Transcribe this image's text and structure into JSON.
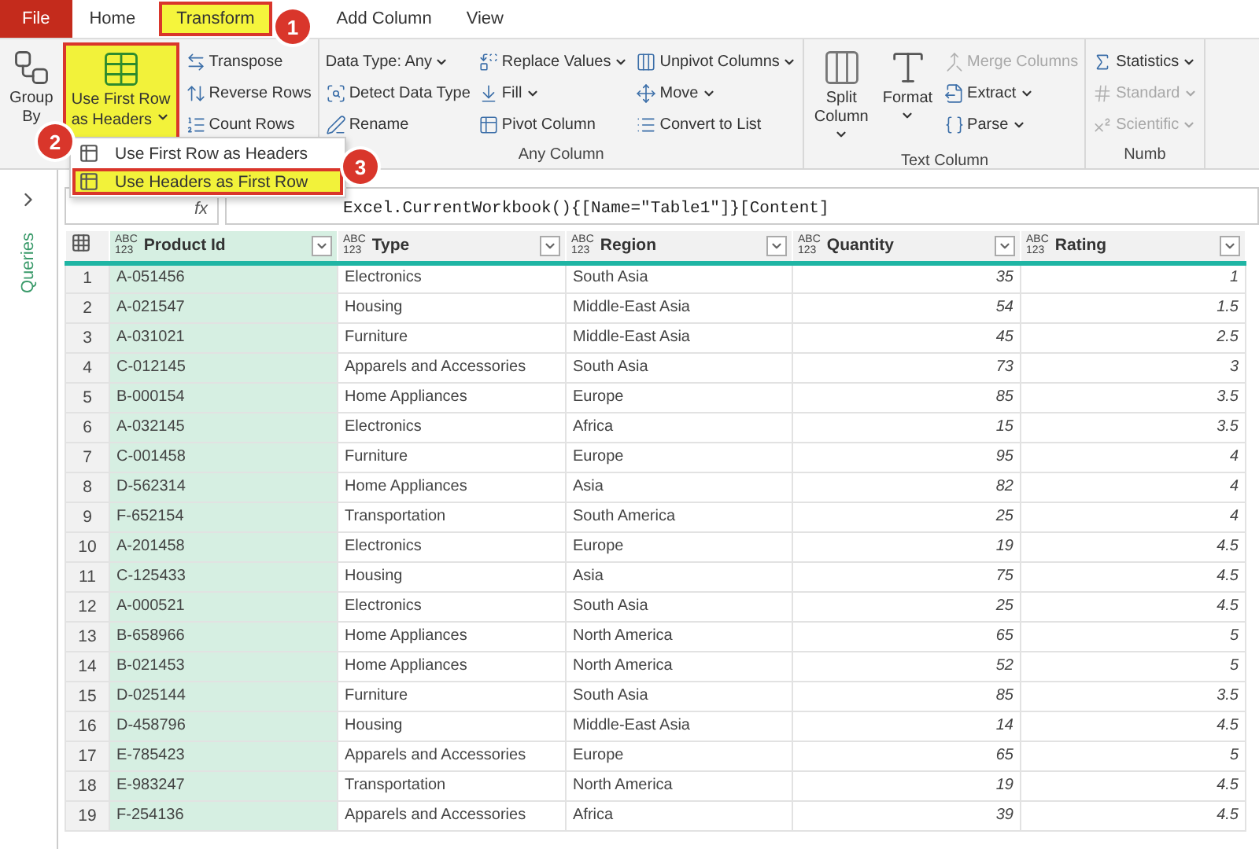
{
  "menu_tabs": [
    {
      "label": "File",
      "kind": "file",
      "selected": false
    },
    {
      "label": "Home",
      "kind": "tab",
      "selected": false
    },
    {
      "label": "Transform",
      "kind": "tab",
      "selected": true
    },
    {
      "label": "Add Column",
      "kind": "tab",
      "selected": false
    },
    {
      "label": "View",
      "kind": "tab",
      "selected": false
    }
  ],
  "ribbon": [
    {
      "columns": [
        {
          "kind": "large",
          "label": "Group By",
          "dropdown": false,
          "highlighted": false
        },
        {
          "kind": "large",
          "label": "Use First Row as Headers",
          "dropdown": true,
          "highlighted": true
        },
        {
          "kind": "stack",
          "items": [
            {
              "label": "Transpose",
              "dropdown": false,
              "disabled": false
            },
            {
              "label": "Reverse Rows",
              "dropdown": false,
              "disabled": false
            },
            {
              "label": "Count Rows",
              "dropdown": false,
              "disabled": false
            }
          ]
        }
      ]
    },
    {
      "label": "Any Column",
      "columns": [
        {
          "kind": "stack",
          "items": [
            {
              "label": "Data Type: Any",
              "dropdown": true,
              "disabled": false
            },
            {
              "label": "Detect Data Type",
              "dropdown": false,
              "disabled": false
            },
            {
              "label": "Rename",
              "dropdown": false,
              "disabled": false
            }
          ]
        },
        {
          "kind": "stack",
          "items": [
            {
              "label": "Replace Values",
              "dropdown": true,
              "disabled": false
            },
            {
              "label": "Fill",
              "dropdown": true,
              "disabled": false
            },
            {
              "label": "Pivot Column",
              "dropdown": false,
              "disabled": false
            }
          ]
        },
        {
          "kind": "stack",
          "items": [
            {
              "label": "Unpivot Columns",
              "dropdown": true,
              "disabled": false
            },
            {
              "label": "Move",
              "dropdown": true,
              "disabled": false
            },
            {
              "label": "Convert to List",
              "dropdown": false,
              "disabled": false
            }
          ]
        }
      ]
    },
    {
      "label": "Text Column",
      "columns": [
        {
          "kind": "large",
          "label": "Split Column",
          "dropdown": true,
          "highlighted": false
        },
        {
          "kind": "large",
          "label": "Format",
          "dropdown": true,
          "highlighted": false
        },
        {
          "kind": "stack",
          "items": [
            {
              "label": "Merge Columns",
              "dropdown": false,
              "disabled": true
            },
            {
              "label": "Extract",
              "dropdown": true,
              "disabled": false
            },
            {
              "label": "Parse",
              "dropdown": true,
              "disabled": false
            }
          ]
        }
      ]
    },
    {
      "label": "Numb",
      "columns": [
        {
          "kind": "stack",
          "items": [
            {
              "label": "Statistics",
              "dropdown": true,
              "disabled": false
            },
            {
              "label": "Standard",
              "dropdown": true,
              "disabled": true
            },
            {
              "label": "Scientific",
              "dropdown": true,
              "disabled": true
            }
          ]
        }
      ]
    }
  ],
  "dropdown_menu": [
    {
      "label": "Use First Row as Headers",
      "highlighted": false
    },
    {
      "label": "Use Headers as First Row",
      "highlighted": true
    }
  ],
  "callouts": [
    "1",
    "2",
    "3"
  ],
  "sidebar": {
    "title": "Queries"
  },
  "formula_bar": {
    "fx": "fx",
    "formula": "Excel.CurrentWorkbook(){[Name=\"Table1\"]}[Content]"
  },
  "table": {
    "columns": [
      {
        "name": "Product Id",
        "type_badge": [
          "ABC",
          "123"
        ],
        "kind": "text",
        "selected": true
      },
      {
        "name": "Type",
        "type_badge": [
          "ABC",
          "123"
        ],
        "kind": "text",
        "selected": false
      },
      {
        "name": "Region",
        "type_badge": [
          "ABC",
          "123"
        ],
        "kind": "text",
        "selected": false
      },
      {
        "name": "Quantity",
        "type_badge": [
          "ABC",
          "123"
        ],
        "kind": "number",
        "selected": false
      },
      {
        "name": "Rating",
        "type_badge": [
          "ABC",
          "123"
        ],
        "kind": "number",
        "selected": false
      }
    ],
    "rows": [
      {
        "number": "1",
        "cells": [
          "A-051456",
          "Electronics",
          "South Asia",
          "35",
          "1"
        ]
      },
      {
        "number": "2",
        "cells": [
          "A-021547",
          "Housing",
          "Middle-East Asia",
          "54",
          "1.5"
        ]
      },
      {
        "number": "3",
        "cells": [
          "A-031021",
          "Furniture",
          "Middle-East Asia",
          "45",
          "2.5"
        ]
      },
      {
        "number": "4",
        "cells": [
          "C-012145",
          "Apparels and Accessories",
          "South Asia",
          "73",
          "3"
        ]
      },
      {
        "number": "5",
        "cells": [
          "B-000154",
          "Home Appliances",
          "Europe",
          "85",
          "3.5"
        ]
      },
      {
        "number": "6",
        "cells": [
          "A-032145",
          "Electronics",
          "Africa",
          "15",
          "3.5"
        ]
      },
      {
        "number": "7",
        "cells": [
          "C-001458",
          "Furniture",
          "Europe",
          "95",
          "4"
        ]
      },
      {
        "number": "8",
        "cells": [
          "D-562314",
          "Home Appliances",
          "Asia",
          "82",
          "4"
        ]
      },
      {
        "number": "9",
        "cells": [
          "F-652154",
          "Transportation",
          "South America",
          "25",
          "4"
        ]
      },
      {
        "number": "10",
        "cells": [
          "A-201458",
          "Electronics",
          "Europe",
          "19",
          "4.5"
        ]
      },
      {
        "number": "11",
        "cells": [
          "C-125433",
          "Housing",
          "Asia",
          "75",
          "4.5"
        ]
      },
      {
        "number": "12",
        "cells": [
          "A-000521",
          "Electronics",
          "South Asia",
          "25",
          "4.5"
        ]
      },
      {
        "number": "13",
        "cells": [
          "B-658966",
          "Home Appliances",
          "North America",
          "65",
          "5"
        ]
      },
      {
        "number": "14",
        "cells": [
          "B-021453",
          "Home Appliances",
          "North America",
          "52",
          "5"
        ]
      },
      {
        "number": "15",
        "cells": [
          "D-025144",
          "Furniture",
          "South Asia",
          "85",
          "3.5"
        ]
      },
      {
        "number": "16",
        "cells": [
          "D-458796",
          "Housing",
          "Middle-East Asia",
          "14",
          "4.5"
        ]
      },
      {
        "number": "17",
        "cells": [
          "E-785423",
          "Apparels and Accessories",
          "Europe",
          "65",
          "5"
        ]
      },
      {
        "number": "18",
        "cells": [
          "E-983247",
          "Transportation",
          "North America",
          "19",
          "4.5"
        ]
      },
      {
        "number": "19",
        "cells": [
          "F-254136",
          "Apparels and Accessories",
          "Africa",
          "39",
          "4.5"
        ]
      }
    ]
  }
}
